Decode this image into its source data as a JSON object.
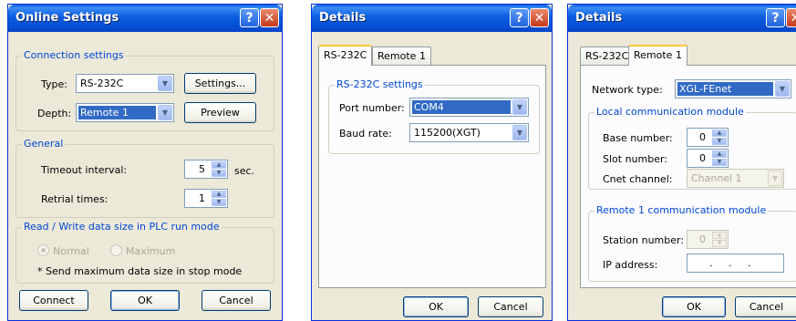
{
  "dialog1": {
    "title": "Online Settings",
    "connection_legend": "Connection settings",
    "type_label": "Type:",
    "type_value": "RS-232C",
    "settings_button": "Settings...",
    "depth_label": "Depth:",
    "depth_value": "Remote 1",
    "preview_button": "Preview",
    "general_legend": "General",
    "timeout_label": "Timeout interval:",
    "timeout_value": "5",
    "timeout_unit": "sec.",
    "retrial_label": "Retrial times:",
    "retrial_value": "1",
    "rw_legend": "Read / Write data size in PLC run mode",
    "normal_label": "Normal",
    "maximum_label": "Maximum",
    "note": "* Send maximum data size in stop mode",
    "connect_button": "Connect",
    "ok_button": "OK",
    "cancel_button": "Cancel"
  },
  "dialog2": {
    "title": "Details",
    "tabs": [
      "RS-232C",
      "Remote 1"
    ],
    "rs_legend": "RS-232C settings",
    "port_label": "Port number:",
    "port_value": "COM4",
    "baud_label": "Baud rate:",
    "baud_value": "115200(XGT)",
    "ok_button": "OK",
    "cancel_button": "Cancel"
  },
  "dialog3": {
    "title": "Details",
    "tabs": [
      "RS-232C",
      "Remote 1"
    ],
    "network_label": "Network type:",
    "network_value": "XGL-FEnet",
    "local_legend": "Local communication module",
    "base_label": "Base number:",
    "base_value": "0",
    "slot_label": "Slot number:",
    "slot_value": "0",
    "cnet_label": "Cnet channel:",
    "cnet_value": "Channel 1",
    "remote_legend": "Remote 1 communication module",
    "station_label": "Station number:",
    "station_value": "0",
    "ip_label": "IP address:",
    "ip_value": ".     .     .",
    "ok_button": "OK",
    "cancel_button": "Cancel"
  },
  "icons": {
    "help": "?",
    "close": "✕",
    "dropdown": "▼",
    "up": "▲",
    "down": "▼"
  },
  "colors": {
    "title_blue": "#0a5ee0",
    "legend_blue": "#0046d5",
    "face": "#ece9d8"
  }
}
